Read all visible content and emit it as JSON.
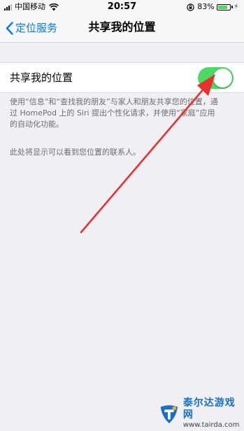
{
  "status_bar": {
    "carrier": "中国移动",
    "time": "20:57",
    "battery_percent": "83%",
    "battery_level": 0.83,
    "battery_color": "#4cd964"
  },
  "nav": {
    "back_label": "定位服务",
    "title": "共享我的位置",
    "tint_color": "#007aff"
  },
  "share_row": {
    "label": "共享我的位置",
    "switch_on": true,
    "switch_color": "#4cd964"
  },
  "footer": {
    "description": "使用“信息”和“查找我的朋友”与家人和朋友共享您的位置，通过 HomePod 上的 Siri 提出个性化请求，并使用“家庭”应用的自动化功能。",
    "contacts_hint": "此处将显示可以看到您位置的联系人。"
  },
  "annotation": {
    "arrow_color": "#e8302f"
  },
  "watermark": {
    "site_name": "泰尔达游戏网",
    "site_url": "www.tairda.com"
  }
}
